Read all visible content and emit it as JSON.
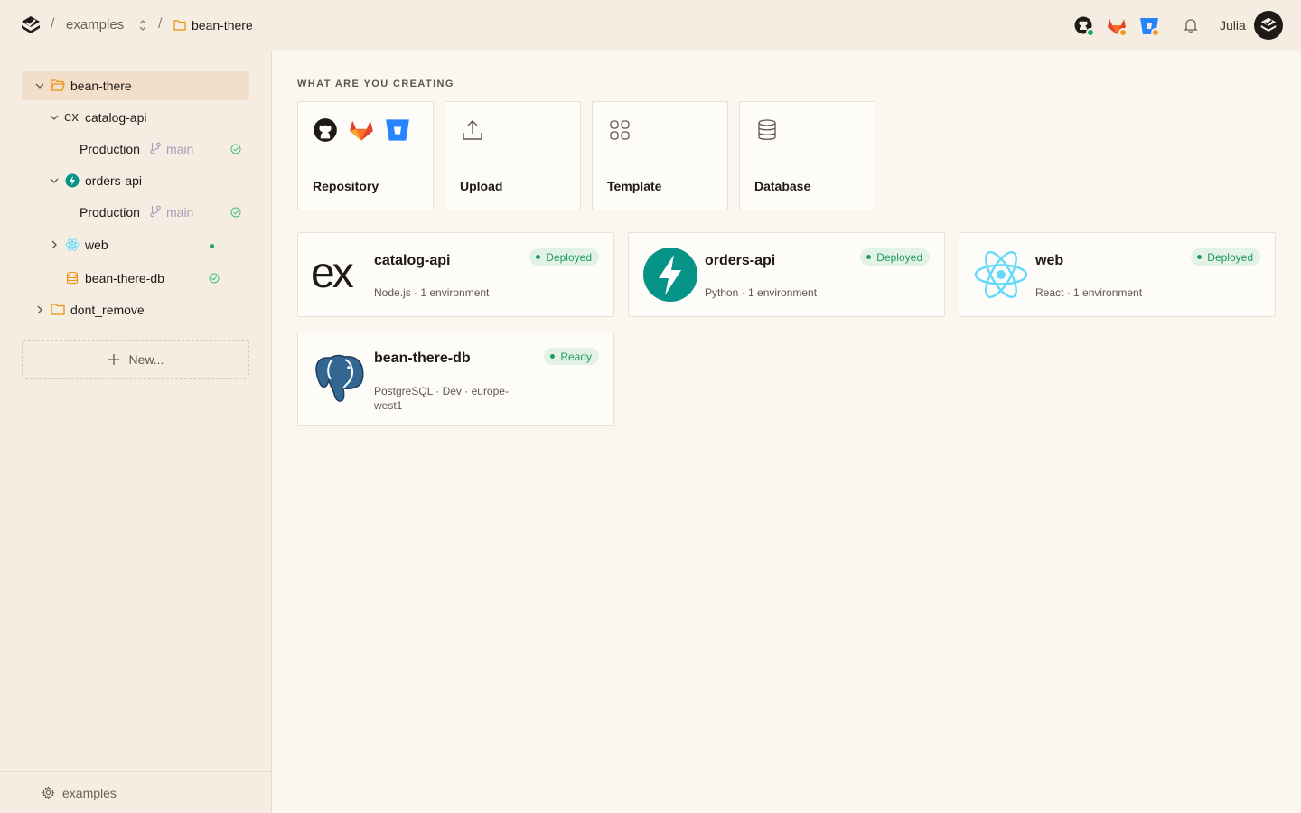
{
  "header": {
    "crumbs": [
      "examples",
      "bean-there"
    ],
    "separator": "/",
    "user": "Julia"
  },
  "sidebar": {
    "tree": [
      {
        "label": "bean-there"
      },
      {
        "label": "catalog-api",
        "prefix": "ex"
      },
      {
        "label": "Production",
        "branch": "main"
      },
      {
        "label": "orders-api"
      },
      {
        "label": "Production",
        "branch": "main"
      },
      {
        "label": "web"
      },
      {
        "label": "bean-there-db"
      },
      {
        "label": "dont_remove"
      }
    ],
    "new_label": "New...",
    "footer_label": "examples"
  },
  "main": {
    "section_label": "WHAT ARE YOU CREATING",
    "create_options": [
      "Repository",
      "Upload",
      "Template",
      "Database"
    ],
    "services": [
      {
        "name": "catalog-api",
        "meta": "Node.js · 1 environment",
        "status": "Deployed",
        "logo_text": "ex"
      },
      {
        "name": "orders-api",
        "meta": "Python · 1 environment",
        "status": "Deployed"
      },
      {
        "name": "web",
        "meta": "React · 1 environment",
        "status": "Deployed"
      },
      {
        "name": "bean-there-db",
        "meta": "PostgreSQL · Dev · europe-west1",
        "status": "Ready"
      }
    ]
  },
  "colors": {
    "accent_green": "#1f9b5e",
    "folder_orange": "#e8920f",
    "fastapi_teal": "#059487",
    "react_blue": "#61dafb"
  }
}
